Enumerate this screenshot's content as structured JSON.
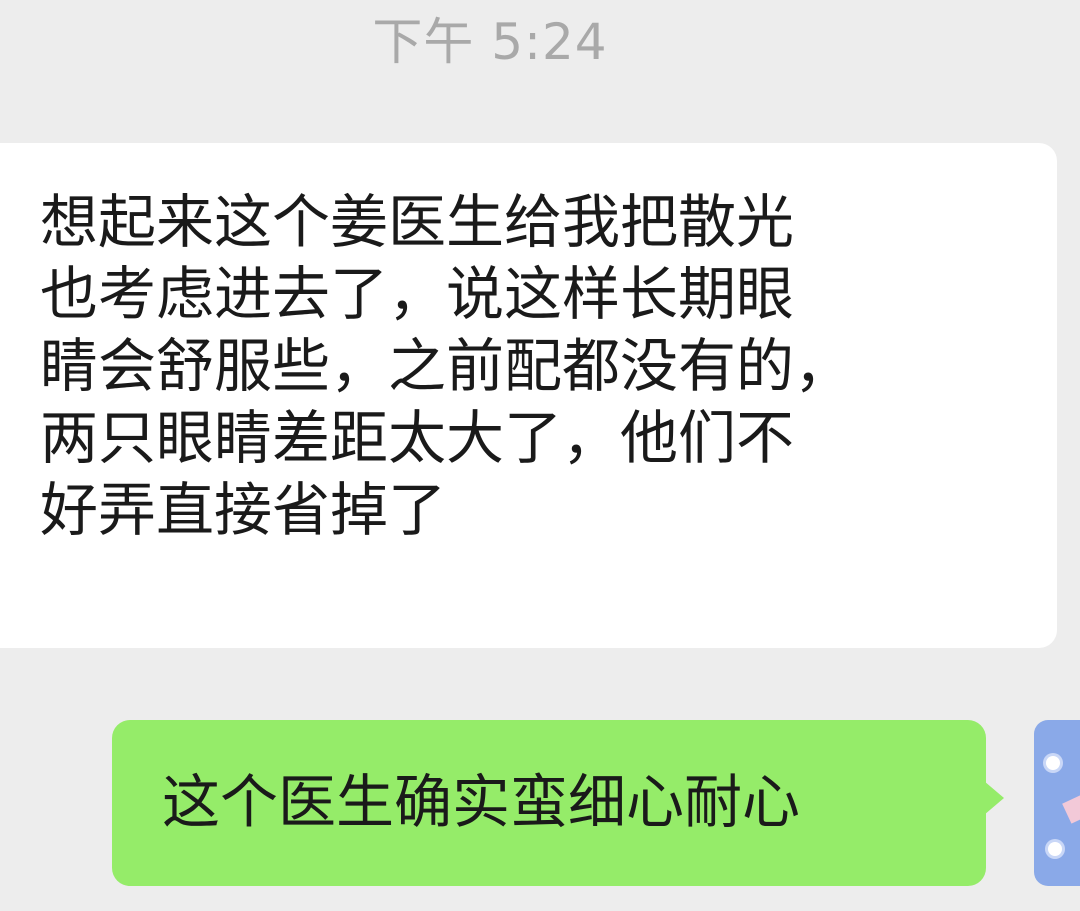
{
  "chat": {
    "timestamp": "下午 5:24",
    "incoming": {
      "lines": [
        "想起来这个姜医生给我把散光",
        "也考虑进去了，说这样长期眼",
        "睛会舒服些，之前配都没有的，",
        "两只眼睛差距太大了，他们不",
        "好弄直接省掉了"
      ]
    },
    "outgoing": {
      "text": "这个医生确实蛮细心耐心"
    }
  },
  "colors": {
    "background": "#ededed",
    "incoming_bubble": "#ffffff",
    "outgoing_bubble": "#95ec69",
    "timestamp_text": "#a9a9a9",
    "message_text": "#1a1a1a",
    "avatar": "#8aa9e8"
  }
}
